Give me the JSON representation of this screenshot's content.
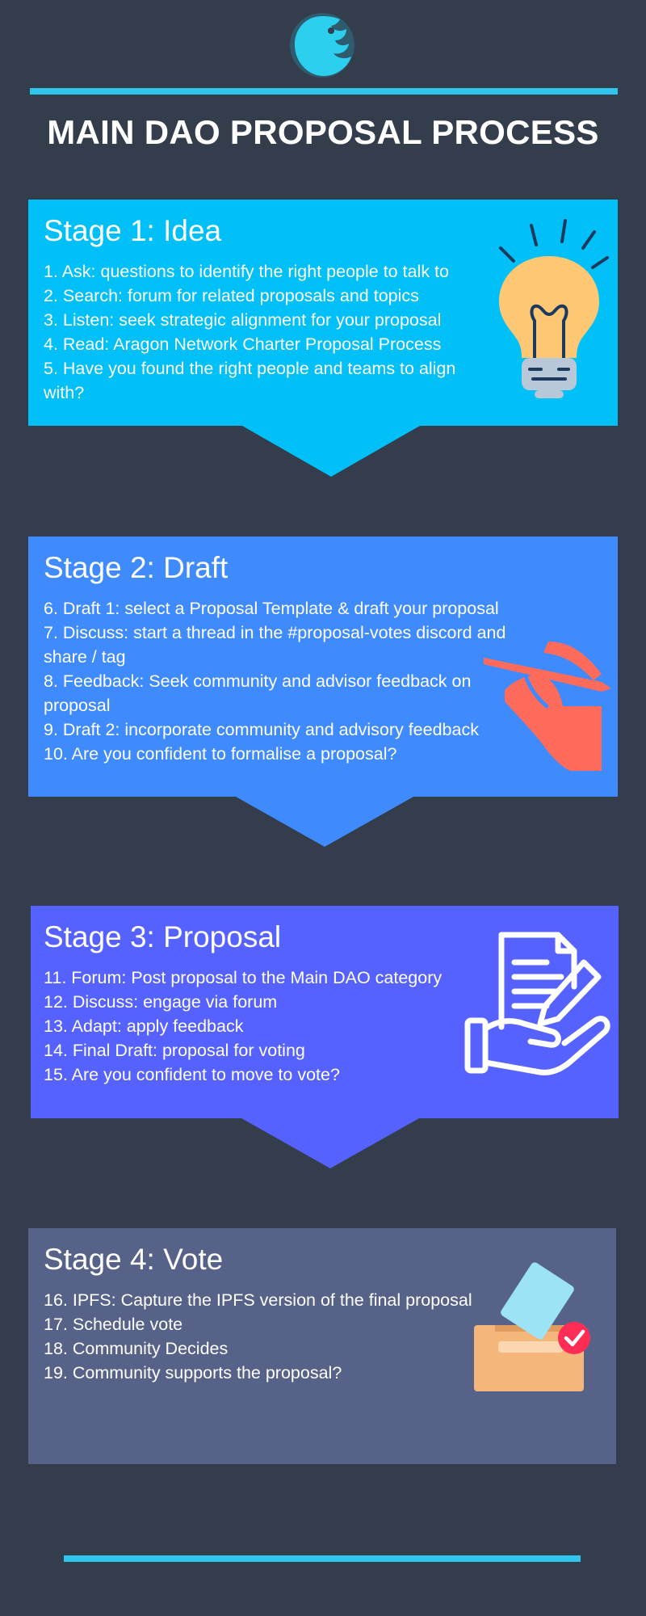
{
  "title": "MAIN DAO PROPOSAL PROCESS",
  "colors": {
    "background": "#333d4b",
    "accent_bar": "#2fc6ee",
    "stage1": "#00c0f7",
    "stage2": "#3f8bfd",
    "stage3": "#5662ff",
    "stage4": "#566287"
  },
  "stages": [
    {
      "heading": "Stage 1: Idea",
      "icon": "lightbulb-icon",
      "items": [
        "1. Ask: questions to identify the right people to talk to",
        "2. Search: forum for related proposals and topics",
        "3. Listen: seek strategic alignment for your proposal",
        "4. Read: Aragon Network Charter Proposal Process",
        "5. Have you found the right people and teams to align with?"
      ]
    },
    {
      "heading": "Stage 2: Draft",
      "icon": "hand-writing-icon",
      "items": [
        "6. Draft 1: select a Proposal Template & draft your proposal",
        "7. Discuss: start a thread in the #proposal-votes discord and share / tag",
        "8. Feedback: Seek community and advisor feedback on proposal",
        "9. Draft 2: incorporate community and advisory feedback",
        "10. Are you confident to formalise a proposal?"
      ]
    },
    {
      "heading": "Stage 3: Proposal",
      "icon": "document-hand-icon",
      "items": [
        "11. Forum: Post proposal to the Main DAO category",
        "12. Discuss: engage via forum",
        "13. Adapt: apply feedback",
        "14. Final Draft: proposal for voting",
        "15. Are you confident to move to vote?"
      ]
    },
    {
      "heading": "Stage 4: Vote",
      "icon": "ballot-box-icon",
      "items": [
        "16. IPFS: Capture the IPFS version of the final proposal",
        "17. Schedule vote",
        "18. Community Decides",
        "19. Community supports the proposal?"
      ]
    }
  ]
}
